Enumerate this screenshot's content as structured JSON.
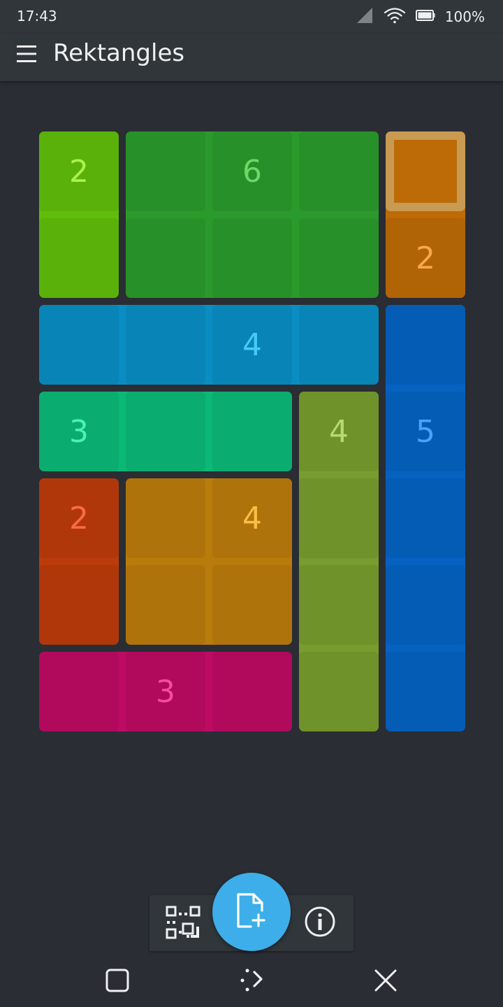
{
  "status": {
    "time": "17:43",
    "battery": "100%"
  },
  "app": {
    "title": "Rektangles"
  },
  "board": {
    "rectangles": [
      {
        "label": "2",
        "color": "#60bd0b",
        "text_color": "#a9f24b"
      },
      {
        "label": "6",
        "color": "#2b9a2c",
        "text_color": "#6ed86a"
      },
      {
        "label": "2",
        "color": "#bd6b07",
        "text_color": "#f8a848"
      },
      {
        "label": "4",
        "color": "#0a8dc2",
        "text_color": "#44cbf5"
      },
      {
        "label": "3",
        "color": "#0bb876",
        "text_color": "#4af3b4"
      },
      {
        "label": "4",
        "color": "#789c2e",
        "text_color": "#b5da6e"
      },
      {
        "label": "5",
        "color": "#0662c1",
        "text_color": "#4aa2f8"
      },
      {
        "label": "2",
        "color": "#bb3b0b",
        "text_color": "#fa6b42"
      },
      {
        "label": "4",
        "color": "#b97c0c",
        "text_color": "#fbbd45"
      },
      {
        "label": "3",
        "color": "#bd0b63",
        "text_color": "#f84a9e"
      }
    ],
    "selection_color": "#c99a52"
  },
  "toolbar": {
    "left_icon": "qr-code-icon",
    "center_icon": "new-document-icon",
    "right_icon": "info-icon",
    "fab_color": "#3daee9"
  },
  "navbar": {
    "icons": [
      "recents-icon",
      "home-icon",
      "close-icon"
    ]
  }
}
